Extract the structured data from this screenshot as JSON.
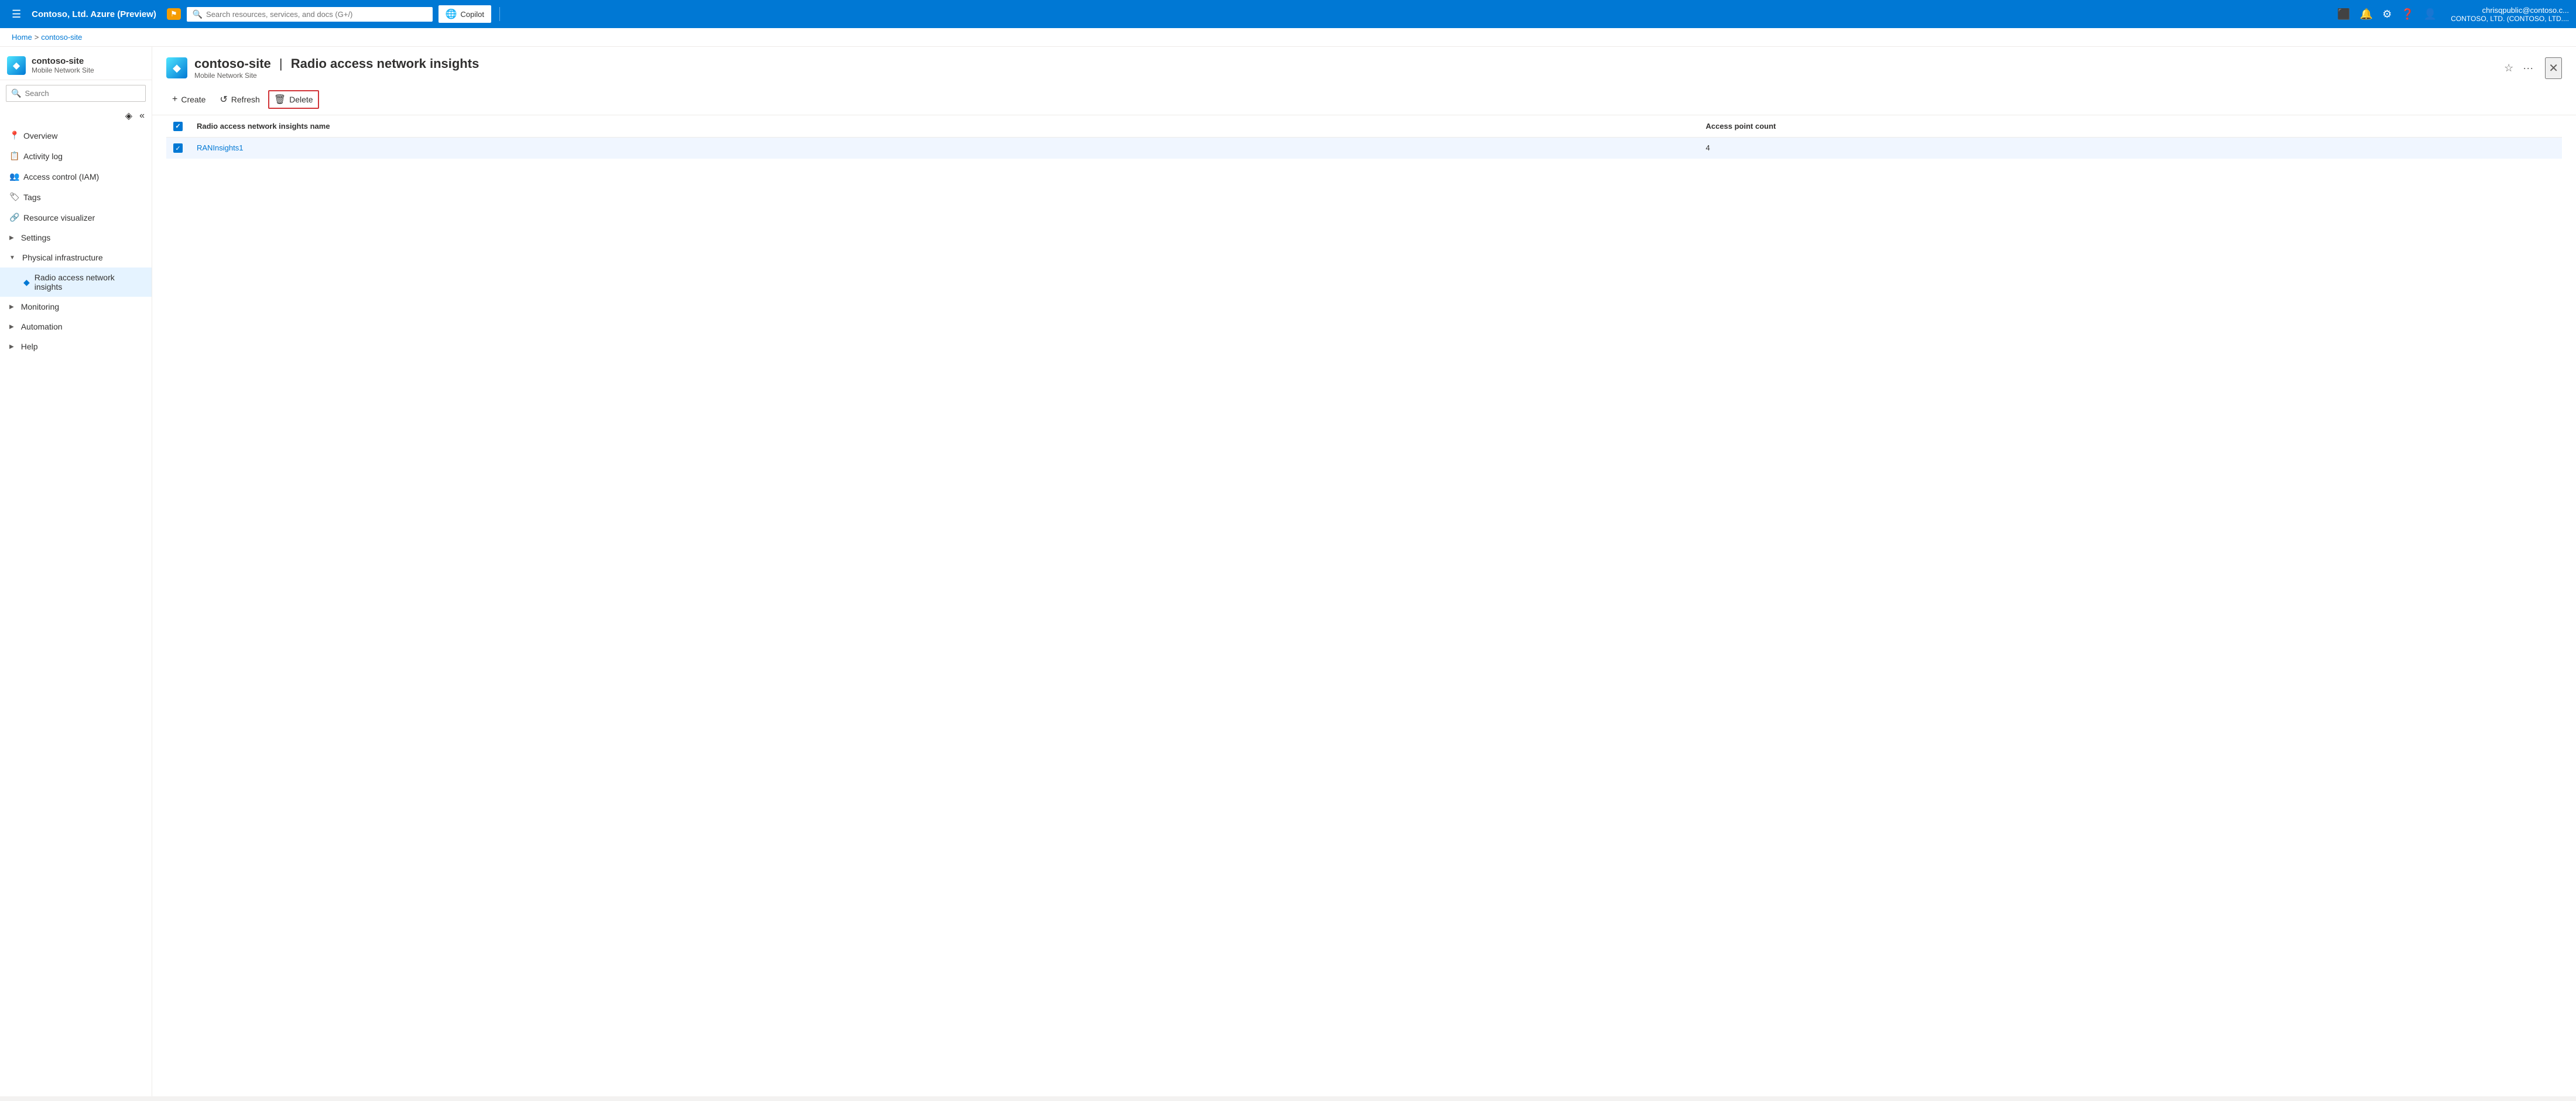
{
  "topnav": {
    "hamburger": "☰",
    "title": "Contoso, Ltd. Azure (Preview)",
    "alert_badge": "⚑",
    "search_placeholder": "Search resources, services, and docs (G+/)",
    "copilot_label": "Copilot",
    "user_name": "chrisqpublic@contoso.c...",
    "user_org": "CONTOSO, LTD. (CONTOSO, LTD....",
    "icons": {
      "terminal": "⬛",
      "bell": "🔔",
      "gear": "⚙",
      "question": "❓",
      "person": "👤"
    }
  },
  "breadcrumb": {
    "home": "Home",
    "separator": ">",
    "current": "contoso-site"
  },
  "sidebar": {
    "resource_name": "contoso-site | Radio access network insights",
    "resource_subtitle": "Mobile Network Site",
    "search_placeholder": "Search",
    "nav_items": [
      {
        "id": "overview",
        "label": "Overview",
        "icon": "📍",
        "active": false
      },
      {
        "id": "activity-log",
        "label": "Activity log",
        "icon": "📋",
        "active": false
      },
      {
        "id": "access-control",
        "label": "Access control (IAM)",
        "icon": "👥",
        "active": false
      },
      {
        "id": "tags",
        "label": "Tags",
        "icon": "🏷",
        "active": false
      },
      {
        "id": "resource-visualizer",
        "label": "Resource visualizer",
        "icon": "🔗",
        "active": false
      },
      {
        "id": "settings",
        "label": "Settings",
        "icon": "",
        "expandable": true,
        "expanded": false
      },
      {
        "id": "physical-infrastructure",
        "label": "Physical infrastructure",
        "icon": "",
        "expandable": true,
        "expanded": true
      },
      {
        "id": "ran-insights",
        "label": "Radio access network insights",
        "icon": "🔷",
        "active": true,
        "sub": true
      },
      {
        "id": "monitoring",
        "label": "Monitoring",
        "icon": "",
        "expandable": true,
        "expanded": false
      },
      {
        "id": "automation",
        "label": "Automation",
        "icon": "",
        "expandable": true,
        "expanded": false
      },
      {
        "id": "help",
        "label": "Help",
        "icon": "",
        "expandable": true,
        "expanded": false
      }
    ]
  },
  "page": {
    "title": "contoso-site | Radio access network insights",
    "subtitle": "Mobile Network Site",
    "resource_icon": "◆",
    "favorite_icon": "☆",
    "more_icon": "···",
    "close_icon": "✕"
  },
  "toolbar": {
    "create_label": "Create",
    "create_icon": "+",
    "refresh_label": "Refresh",
    "refresh_icon": "↺",
    "delete_label": "Delete",
    "delete_icon": "🗑"
  },
  "table": {
    "col_checkbox": "",
    "col_name": "Radio access network insights name",
    "col_access_point_count": "Access point count",
    "rows": [
      {
        "id": "ran1",
        "name": "RANInsights1",
        "access_point_count": "4",
        "selected": true
      }
    ]
  }
}
